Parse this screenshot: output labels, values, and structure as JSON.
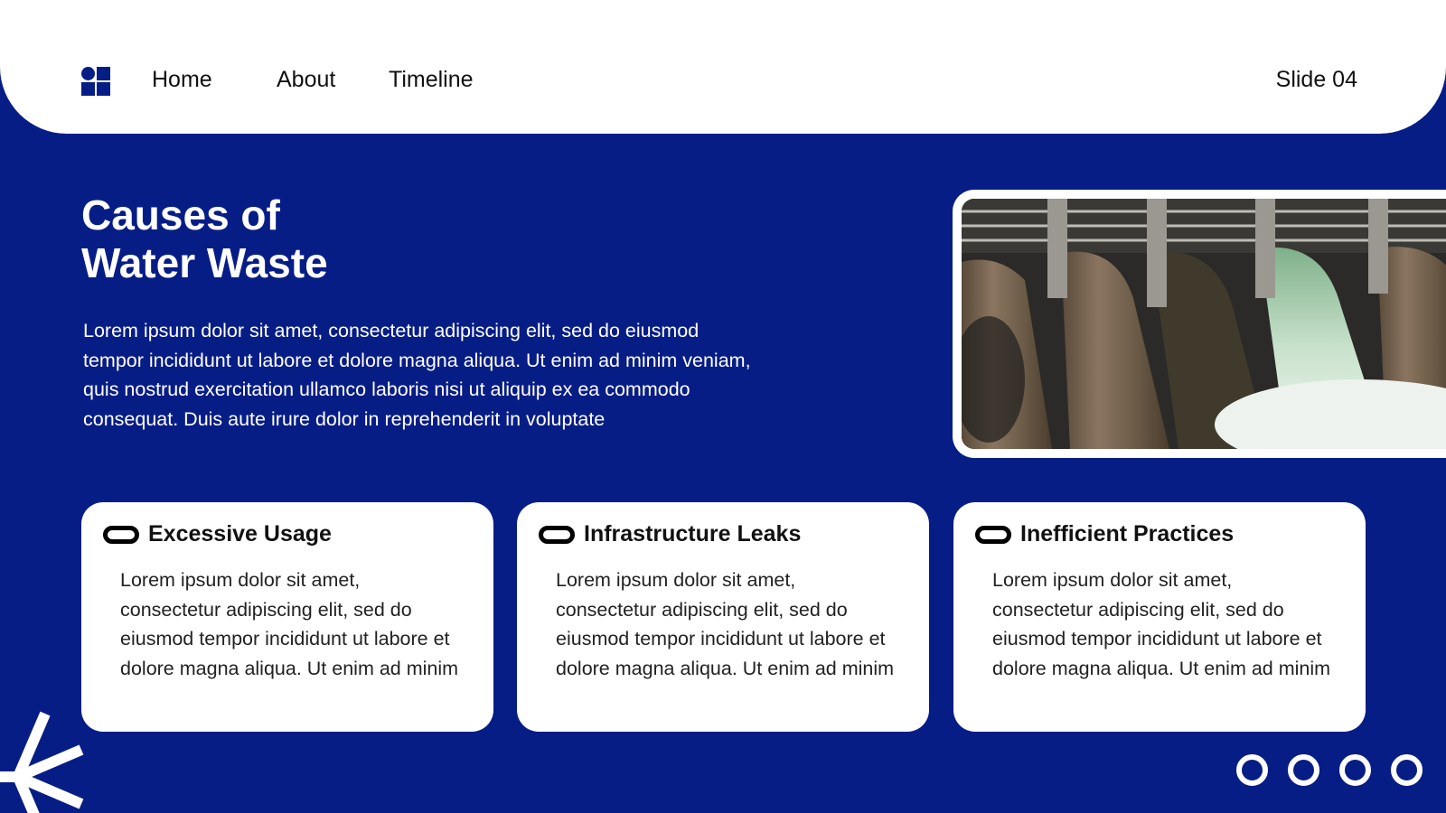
{
  "nav": {
    "logo_icon": "grid-logo-icon",
    "links": [
      "Home",
      "About",
      "Timeline"
    ],
    "slide_label": "Slide 04"
  },
  "main": {
    "title_line1": "Causes of",
    "title_line2": "Water Waste",
    "intro": "Lorem ipsum dolor sit amet, consectetur adipiscing elit, sed do eiusmod tempor incididunt ut labore et dolore magna aliqua. Ut enim ad minim veniam, quis nostrud exercitation ullamco laboris nisi ut aliquip ex ea commodo consequat. Duis aute irure dolor in reprehenderit in voluptate",
    "image_icon": "dam-spillway-photo"
  },
  "cards": [
    {
      "icon": "pill-icon",
      "title": "Excessive Usage",
      "text": "Lorem ipsum dolor sit amet, consectetur adipiscing elit, sed do eiusmod tempor incididunt ut labore et dolore magna aliqua. Ut enim ad minim"
    },
    {
      "icon": "pill-icon",
      "title": "Infrastructure Leaks",
      "text": "Lorem ipsum dolor sit amet, consectetur adipiscing elit, sed do eiusmod tempor incididunt ut labore et dolore magna aliqua. Ut enim ad minim"
    },
    {
      "icon": "pill-icon",
      "title": "Inefficient Practices",
      "text": "Lorem ipsum dolor sit amet, consectetur adipiscing elit, sed do eiusmod tempor incididunt ut labore et dolore magna aliqua. Ut enim ad minim"
    }
  ],
  "pagination": {
    "count": 4,
    "icon": "circle-outline-icon"
  },
  "decoration": {
    "icon": "asterisk-icon"
  },
  "colors": {
    "background": "#071d86",
    "card": "#ffffff",
    "text_dark": "#111111"
  }
}
